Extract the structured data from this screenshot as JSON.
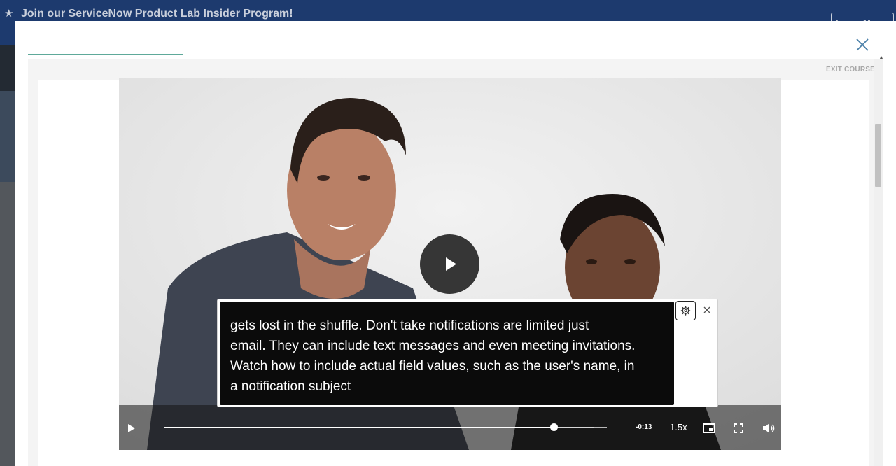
{
  "banner": {
    "star_glyph": "★",
    "text": "Join our ServiceNow Product Lab Insider Program!",
    "button_label": "Learn More"
  },
  "modal": {
    "exit_label": "EXIT COURSE",
    "icons": {
      "close": "close-icon",
      "scroll_up": "scroll-up-arrow-icon"
    }
  },
  "player": {
    "time_remaining": "-0:13",
    "playback_speed": "1.5x",
    "progress_fraction": 0.88,
    "buffered_fraction": 0.97,
    "icons": {
      "big_play": "play-icon",
      "play": "play-icon",
      "pip": "picture-in-picture-icon",
      "fullscreen": "fullscreen-icon",
      "volume": "volume-icon"
    }
  },
  "captions": {
    "lines": [
      "gets lost in the shuffle. Don't take notifications are limited just",
      "email. They can include text messages and even meeting invitations.",
      "Watch how to include actual field values, such as the user's name, in",
      "a notification subject"
    ],
    "icons": {
      "settings": "gear-icon",
      "close": "close-icon"
    }
  },
  "colors": {
    "banner_bg": "#1d3a6e",
    "modal_progress": "#5fa99a",
    "close_x": "#4a7fa8"
  }
}
